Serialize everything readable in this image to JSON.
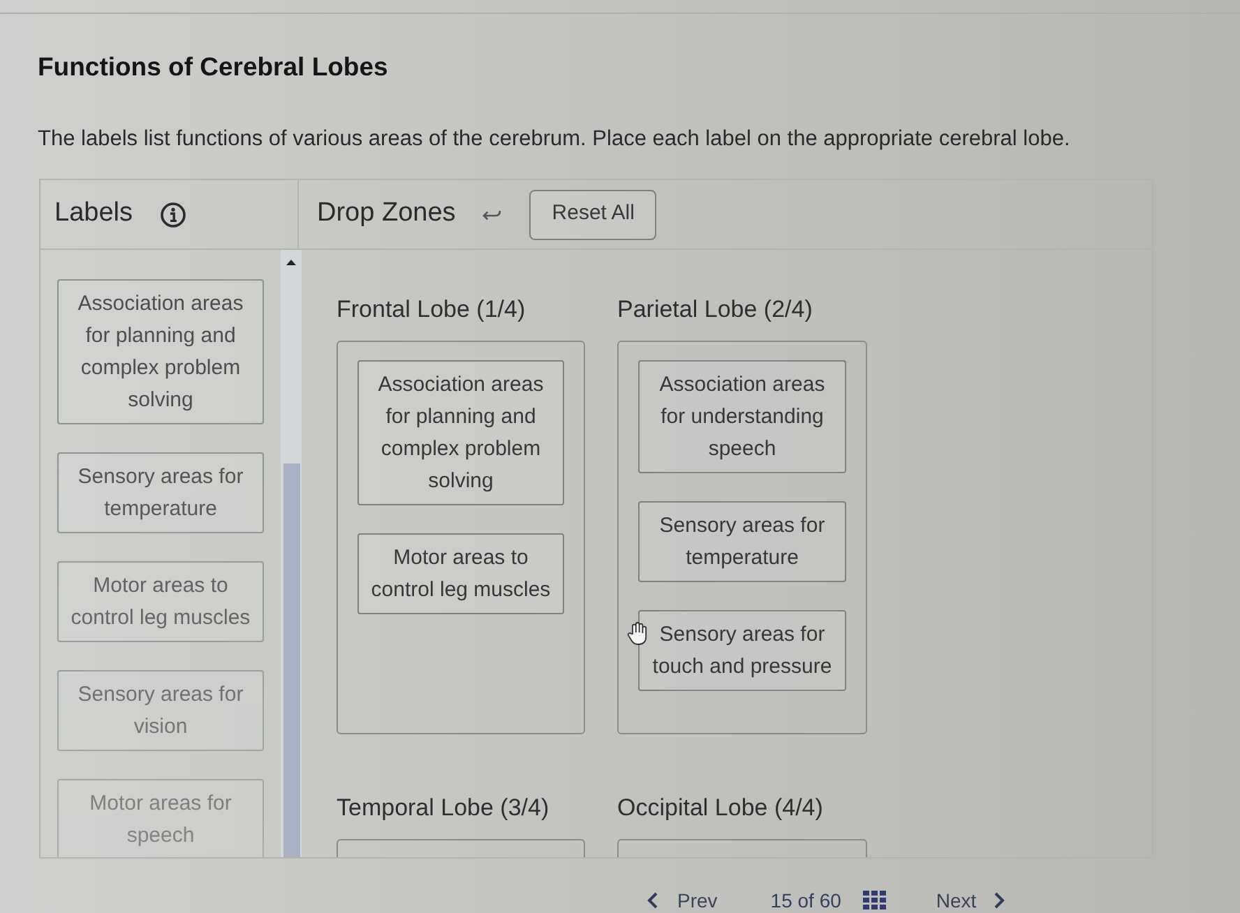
{
  "page": {
    "title": "Functions of Cerebral Lobes",
    "instructions": "The labels list functions of various areas of the cerebrum. Place each label on the appropriate cerebral lobe."
  },
  "labels_panel": {
    "heading": "Labels",
    "labels": [
      "Association areas for planning and complex problem solving",
      "Sensory areas for temperature",
      "Motor areas to control leg muscles",
      "Sensory areas for vision",
      "Motor areas for speech"
    ]
  },
  "drop_zones_panel": {
    "heading": "Drop Zones",
    "reset_button": "Reset All",
    "zones": [
      {
        "title": "Frontal Lobe (1/4)",
        "labels": [
          "Association areas for planning and complex problem solving",
          "Motor areas to control leg muscles"
        ]
      },
      {
        "title": "Parietal Lobe (2/4)",
        "labels": [
          "Association areas for understanding speech",
          "Sensory areas for temperature",
          "Sensory areas for touch and pressure"
        ]
      },
      {
        "title": "Temporal Lobe (3/4)"
      },
      {
        "title": "Occipital Lobe (4/4)"
      }
    ]
  },
  "navigation": {
    "prev": "Prev",
    "position": "15 of 60",
    "next": "Next"
  }
}
